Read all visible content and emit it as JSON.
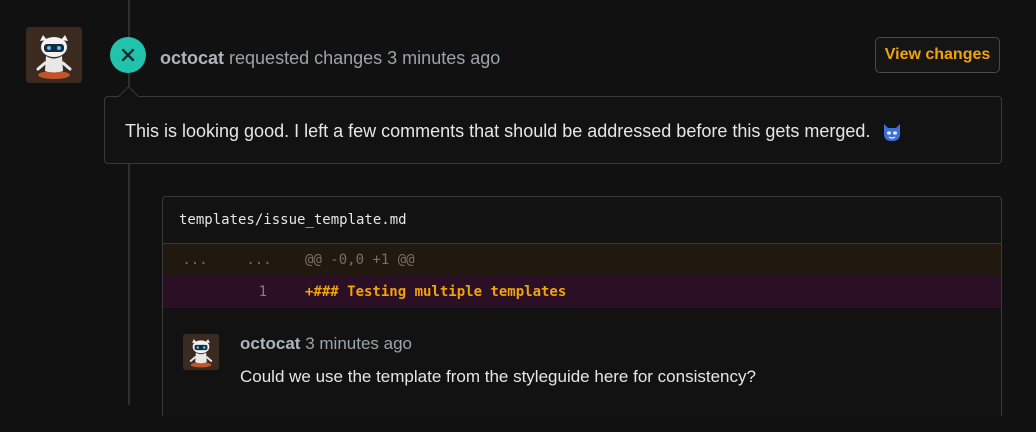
{
  "review": {
    "author": "octocat",
    "action": "requested changes",
    "time": "3 minutes ago",
    "view_changes_label": "View changes",
    "body": "This is looking good. I left a few comments that should be addressed before this gets merged.",
    "emoji": "cat-face-icon",
    "status_icon": "x-icon",
    "status_color": "#21c3ad"
  },
  "file": {
    "path": "templates/issue_template.md",
    "hunk": {
      "old_num": "...",
      "new_num": "...",
      "text": "@@ -0,0 +1 @@"
    },
    "added_line": {
      "old_num": "",
      "new_num": "1",
      "text": "+### Testing multiple templates"
    }
  },
  "comment": {
    "author": "octocat",
    "time": "3 minutes ago",
    "body": "Could we use the template from the styleguide here for consistency?"
  },
  "colors": {
    "background": "#111111",
    "accent": "#f0a30a",
    "hunk_bg": "#21180f",
    "added_bg": "#2a0f25"
  }
}
